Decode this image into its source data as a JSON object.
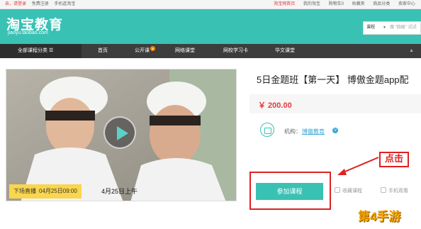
{
  "topbar": {
    "login_prompt": "亲，请登录",
    "register": "免费注册",
    "mobile": "手机逛淘宝",
    "links": [
      "淘宝网首页",
      "我的淘宝",
      "购物车0",
      "收藏夹",
      "商品分类",
      "卖家中心"
    ]
  },
  "header": {
    "logo_cn": "淘宝教育",
    "logo_url": "jiaoyu.taobao.com",
    "search_category": "课程",
    "search_placeholder": "搜 \"四级\" 试试"
  },
  "nav": {
    "all_categories": "全部课程分类  ☰",
    "items": [
      "首页",
      "公开课",
      "网络课堂",
      "网校学习卡",
      "华文课堂"
    ]
  },
  "course": {
    "live_tag": "下场直播",
    "live_time": "04月25日09:00",
    "start_text": "4月25日上午",
    "title": "5日金题班【第一天】 博傲金题app配",
    "price": "￥ 200.00",
    "org_label": "机构：",
    "org_name": "博傲教育",
    "verified_badge": "V",
    "join_button": "参加课程",
    "favorite": "收藏课程",
    "mobile_watch": "手机观看"
  },
  "annotation": {
    "click_label": "点击",
    "color": "#e02020"
  },
  "watermark": "第4手游",
  "colors": {
    "brand": "#39c1b4",
    "nav_bg": "#3d3d3d",
    "price": "#e4393c",
    "live_tag": "#f9d64d"
  }
}
